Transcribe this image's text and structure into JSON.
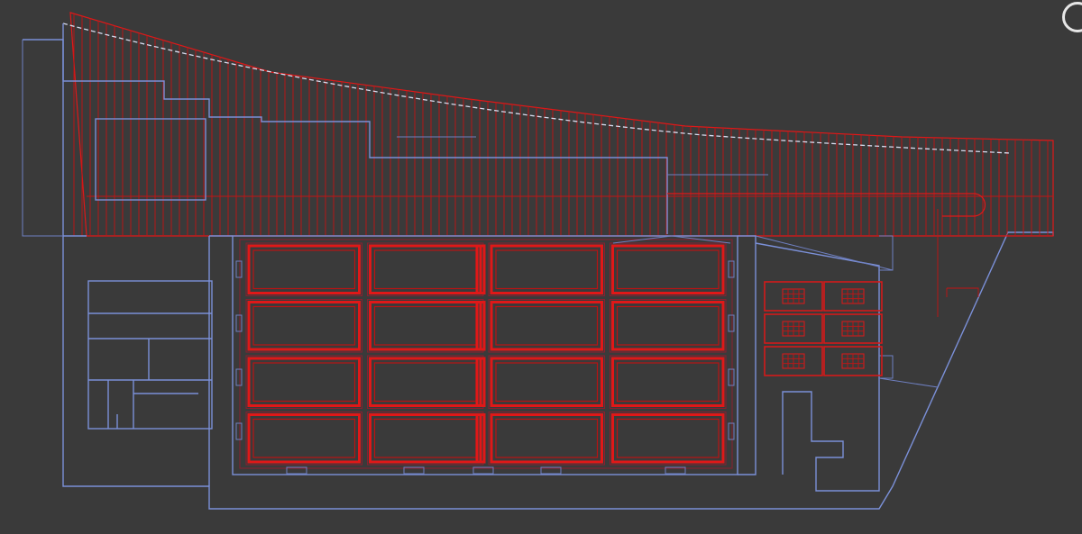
{
  "drawing": {
    "background": "#3a3a3a",
    "colors": {
      "outline": "#7b90d8",
      "roof_hatch": "#e01818",
      "ridge_line": "#d8dcef",
      "bay": "#e01818"
    },
    "bays": {
      "rows": 4,
      "cols": 4
    },
    "units": {
      "rows": 3,
      "cols": 2
    }
  },
  "logo": {
    "icon": "circle-logo-icon"
  }
}
